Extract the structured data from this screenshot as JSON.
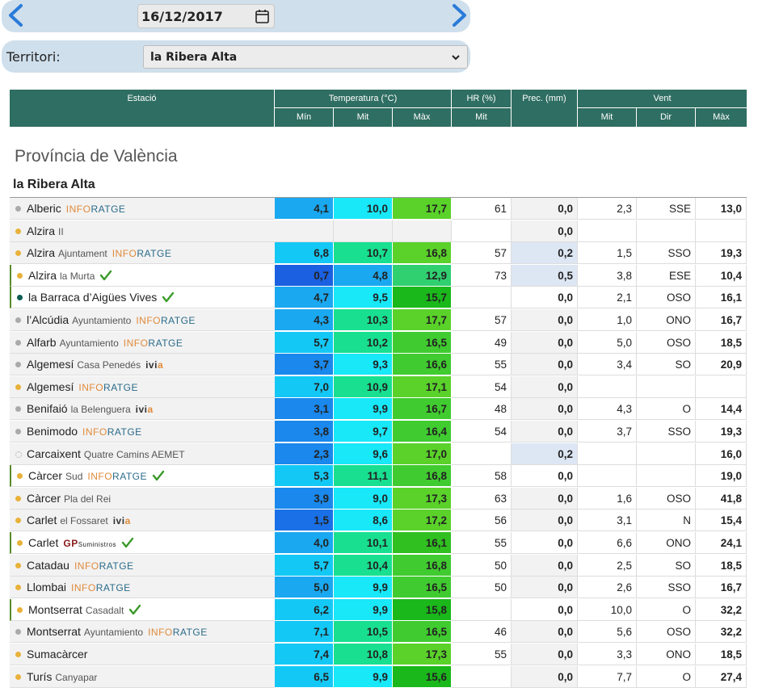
{
  "date": "16/12/2017",
  "territory": {
    "label": "Territori:",
    "selected": "la Ribera Alta"
  },
  "headers": {
    "station": "Estació",
    "temperature": "Temperatura (°C)",
    "hr": "HR (%)",
    "prec": "Prec. (mm)",
    "wind": "Vent",
    "min": "Mín",
    "mit": "Mit",
    "max": "Màx",
    "hr_mit": "Mit",
    "wind_mit": "Mit",
    "wind_dir": "Dir",
    "wind_max": "Màx"
  },
  "province": "Província de València",
  "region": "la Ribera Alta",
  "colors": {
    "header": "#2f6e62",
    "bar": "#cfdfec",
    "prec_highlight": "#dde6f3"
  },
  "rows": [
    {
      "name": "Alberic",
      "loc": "",
      "net": "inforatge",
      "dot": "gray",
      "hl": false,
      "bg": "gray",
      "check": false,
      "min": "4,1",
      "mit": "10,0",
      "max": "17,7",
      "hr": "61",
      "prec": "0,0",
      "precHl": false,
      "wmit": "2,3",
      "wdir": "SSE",
      "wmax": "13,0",
      "cMin": "#1aa8f0",
      "cMit": "#18e8f8",
      "cMax": "#5ad22a"
    },
    {
      "name": "Alzira",
      "loc": "II",
      "net": "",
      "dot": "yellow",
      "hl": false,
      "bg": "gray",
      "check": false,
      "min": "",
      "mit": "",
      "max": "",
      "hr": "",
      "prec": "0,0",
      "precHl": false,
      "wmit": "",
      "wdir": "",
      "wmax": "",
      "cMin": "",
      "cMit": "",
      "cMax": ""
    },
    {
      "name": "Alzira",
      "loc": "Ajuntament",
      "net": "inforatge",
      "dot": "yellow",
      "hl": false,
      "bg": "gray",
      "check": false,
      "min": "6,8",
      "mit": "10,7",
      "max": "16,8",
      "hr": "57",
      "prec": "0,2",
      "precHl": true,
      "wmit": "1,5",
      "wdir": "SSO",
      "wmax": "19,3",
      "cMin": "#14c8f5",
      "cMit": "#18e090",
      "cMax": "#5ad22a"
    },
    {
      "name": "Alzira",
      "loc": "la Murta",
      "net": "",
      "dot": "yellow",
      "hl": true,
      "bg": "white",
      "check": true,
      "min": "0,7",
      "mit": "4,8",
      "max": "12,9",
      "hr": "73",
      "prec": "0,5",
      "precHl": true,
      "wmit": "3,8",
      "wdir": "ESE",
      "wmax": "10,4",
      "cMin": "#1a60e0",
      "cMit": "#1aa8f0",
      "cMax": "#30d070"
    },
    {
      "name": "la Barraca d’Aigües Vives",
      "loc": "",
      "net": "",
      "dot": "teal",
      "hl": true,
      "bg": "white",
      "check": true,
      "min": "4,7",
      "mit": "9,5",
      "max": "15,7",
      "hr": "",
      "prec": "0,0",
      "precHl": false,
      "wmit": "2,1",
      "wdir": "OSO",
      "wmax": "16,1",
      "cMin": "#1aa8f0",
      "cMit": "#18e8f8",
      "cMax": "#1ab81a"
    },
    {
      "name": "l’Alcúdia",
      "loc": "Ayuntamiento",
      "net": "inforatge",
      "dot": "gray",
      "hl": false,
      "bg": "gray",
      "check": false,
      "min": "4,3",
      "mit": "10,3",
      "max": "17,7",
      "hr": "57",
      "prec": "0,0",
      "precHl": false,
      "wmit": "1,0",
      "wdir": "ONO",
      "wmax": "16,7",
      "cMin": "#1aa8f0",
      "cMit": "#18e090",
      "cMax": "#5ad22a"
    },
    {
      "name": "Alfarb",
      "loc": "Ayuntamiento",
      "net": "inforatge",
      "dot": "gray",
      "hl": false,
      "bg": "gray",
      "check": false,
      "min": "5,7",
      "mit": "10,2",
      "max": "16,5",
      "hr": "49",
      "prec": "0,0",
      "precHl": false,
      "wmit": "5,0",
      "wdir": "OSO",
      "wmax": "18,5",
      "cMin": "#14c8f5",
      "cMit": "#18e090",
      "cMax": "#40cc30"
    },
    {
      "name": "Algemesí",
      "loc": "Casa Penedés",
      "net": "ivia",
      "dot": "gray",
      "hl": false,
      "bg": "gray",
      "check": false,
      "min": "3,7",
      "mit": "9,3",
      "max": "16,6",
      "hr": "55",
      "prec": "0,0",
      "precHl": false,
      "wmit": "3,4",
      "wdir": "SO",
      "wmax": "20,9",
      "cMin": "#1a88ec",
      "cMit": "#18e8f8",
      "cMax": "#40cc30"
    },
    {
      "name": "Algemesí",
      "loc": "",
      "net": "inforatge",
      "dot": "yellow",
      "hl": false,
      "bg": "gray",
      "check": false,
      "min": "7,0",
      "mit": "10,9",
      "max": "17,1",
      "hr": "54",
      "prec": "0,0",
      "precHl": false,
      "wmit": "",
      "wdir": "",
      "wmax": "",
      "cMin": "#14c8f5",
      "cMit": "#18e090",
      "cMax": "#5ad22a"
    },
    {
      "name": "Benifaió",
      "loc": "la Belenguera",
      "net": "ivia",
      "dot": "gray",
      "hl": false,
      "bg": "gray",
      "check": false,
      "min": "3,1",
      "mit": "9,9",
      "max": "16,7",
      "hr": "48",
      "prec": "0,0",
      "precHl": false,
      "wmit": "4,3",
      "wdir": "O",
      "wmax": "14,4",
      "cMin": "#1a88ec",
      "cMit": "#18e8f8",
      "cMax": "#40cc30"
    },
    {
      "name": "Benimodo",
      "loc": "",
      "net": "inforatge",
      "dot": "gray",
      "hl": false,
      "bg": "gray",
      "check": false,
      "min": "3,8",
      "mit": "9,7",
      "max": "16,4",
      "hr": "54",
      "prec": "0,0",
      "precHl": false,
      "wmit": "3,7",
      "wdir": "SSO",
      "wmax": "19,3",
      "cMin": "#1a88ec",
      "cMit": "#18e8f8",
      "cMax": "#40cc30"
    },
    {
      "name": "Carcaixent",
      "loc": "Quatre Camins AEMET",
      "net": "",
      "dot": "empty",
      "hl": false,
      "bg": "gray",
      "check": false,
      "min": "2,3",
      "mit": "9,6",
      "max": "17,0",
      "hr": "",
      "prec": "0,2",
      "precHl": true,
      "wmit": "",
      "wdir": "",
      "wmax": "16,0",
      "cMin": "#1a88ec",
      "cMit": "#18e8f8",
      "cMax": "#5ad22a"
    },
    {
      "name": "Càrcer",
      "loc": "Sud",
      "net": "inforatge",
      "dot": "yellow",
      "hl": true,
      "bg": "white",
      "check": true,
      "min": "5,3",
      "mit": "11,1",
      "max": "16,8",
      "hr": "58",
      "prec": "0,0",
      "precHl": false,
      "wmit": "",
      "wdir": "",
      "wmax": "19,0",
      "cMin": "#14c8f5",
      "cMit": "#18e090",
      "cMax": "#40cc30"
    },
    {
      "name": "Càrcer",
      "loc": "Pla del Rei",
      "net": "",
      "dot": "yellow",
      "hl": false,
      "bg": "gray",
      "check": false,
      "min": "3,9",
      "mit": "9,0",
      "max": "17,3",
      "hr": "63",
      "prec": "0,0",
      "precHl": false,
      "wmit": "1,6",
      "wdir": "OSO",
      "wmax": "41,8",
      "cMin": "#1a88ec",
      "cMit": "#18e8f8",
      "cMax": "#5ad22a"
    },
    {
      "name": "Carlet",
      "loc": "el Fossaret",
      "net": "ivia",
      "dot": "yellow",
      "hl": false,
      "bg": "gray",
      "check": false,
      "min": "1,5",
      "mit": "8,6",
      "max": "17,2",
      "hr": "56",
      "prec": "0,0",
      "precHl": false,
      "wmit": "3,1",
      "wdir": "N",
      "wmax": "15,4",
      "cMin": "#1a70e6",
      "cMit": "#18e8f8",
      "cMax": "#5ad22a"
    },
    {
      "name": "Carlet",
      "loc": "",
      "net": "gp",
      "dot": "yellow",
      "hl": true,
      "bg": "white",
      "check": true,
      "min": "4,0",
      "mit": "10,1",
      "max": "16,1",
      "hr": "55",
      "prec": "0,0",
      "precHl": false,
      "wmit": "6,6",
      "wdir": "ONO",
      "wmax": "24,1",
      "cMin": "#1aa8f0",
      "cMit": "#18e090",
      "cMax": "#30c020"
    },
    {
      "name": "Catadau",
      "loc": "",
      "net": "inforatge",
      "dot": "yellow",
      "hl": false,
      "bg": "gray",
      "check": false,
      "min": "5,7",
      "mit": "10,4",
      "max": "16,8",
      "hr": "50",
      "prec": "0,0",
      "precHl": false,
      "wmit": "2,5",
      "wdir": "SO",
      "wmax": "18,5",
      "cMin": "#14c8f5",
      "cMit": "#18e090",
      "cMax": "#40cc30"
    },
    {
      "name": "Llombai",
      "loc": "",
      "net": "inforatge",
      "dot": "yellow",
      "hl": false,
      "bg": "gray",
      "check": false,
      "min": "5,0",
      "mit": "9,9",
      "max": "16,5",
      "hr": "50",
      "prec": "0,0",
      "precHl": false,
      "wmit": "2,6",
      "wdir": "SSO",
      "wmax": "16,7",
      "cMin": "#1aa8f0",
      "cMit": "#18e8f8",
      "cMax": "#40cc30"
    },
    {
      "name": "Montserrat",
      "loc": "Casadalt",
      "net": "",
      "dot": "yellow",
      "hl": true,
      "bg": "white",
      "check": true,
      "min": "6,2",
      "mit": "9,9",
      "max": "15,8",
      "hr": "",
      "prec": "0,0",
      "precHl": false,
      "wmit": "10,0",
      "wdir": "O",
      "wmax": "32,2",
      "cMin": "#14c8f5",
      "cMit": "#18e8f8",
      "cMax": "#1ab81a"
    },
    {
      "name": "Montserrat",
      "loc": "Ayuntamiento",
      "net": "inforatge",
      "dot": "gray",
      "hl": false,
      "bg": "gray",
      "check": false,
      "min": "7,1",
      "mit": "10,5",
      "max": "16,5",
      "hr": "46",
      "prec": "0,0",
      "precHl": false,
      "wmit": "5,6",
      "wdir": "OSO",
      "wmax": "32,2",
      "cMin": "#14c8f5",
      "cMit": "#18e090",
      "cMax": "#40cc30"
    },
    {
      "name": "Sumacàrcer",
      "loc": "",
      "net": "",
      "dot": "yellow",
      "hl": false,
      "bg": "gray",
      "check": false,
      "min": "7,4",
      "mit": "10,8",
      "max": "17,3",
      "hr": "55",
      "prec": "0,0",
      "precHl": false,
      "wmit": "3,3",
      "wdir": "ONO",
      "wmax": "18,5",
      "cMin": "#14c8f5",
      "cMit": "#18e090",
      "cMax": "#5ad22a"
    },
    {
      "name": "Turís",
      "loc": "Canyapar",
      "net": "",
      "dot": "yellow",
      "hl": false,
      "bg": "gray",
      "check": false,
      "min": "6,5",
      "mit": "9,9",
      "max": "15,6",
      "hr": "",
      "prec": "0,0",
      "precHl": false,
      "wmit": "7,7",
      "wdir": "O",
      "wmax": "27,4",
      "cMin": "#14c8f5",
      "cMit": "#18e8f8",
      "cMax": "#1ab81a"
    }
  ]
}
